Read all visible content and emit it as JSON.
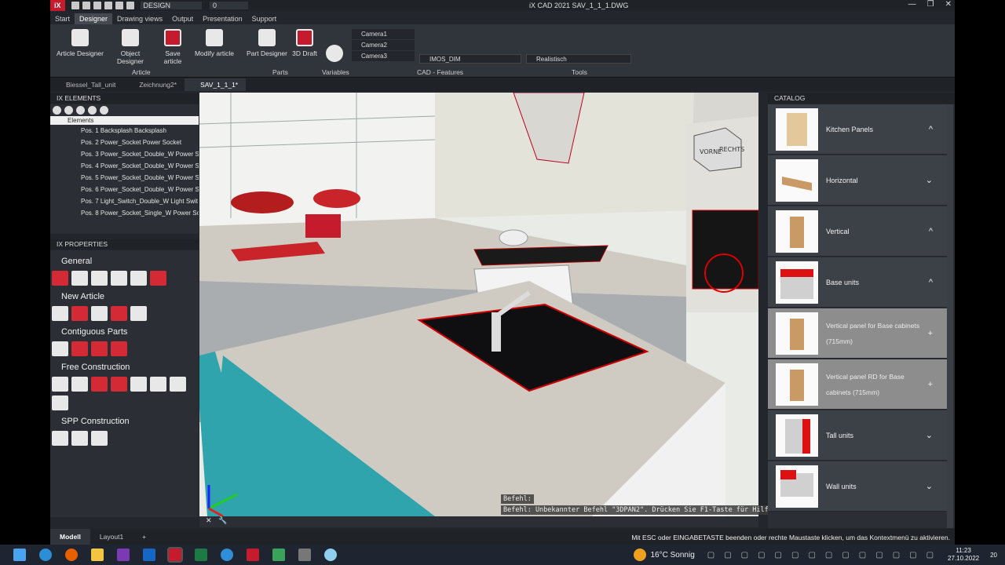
{
  "app": {
    "logo": "iX",
    "workspace": "DESIGN",
    "layer": "0",
    "window_title": "iX CAD 2021    SAV_1_1_1.DWG"
  },
  "menu": [
    "Start",
    "Designer",
    "Drawing views",
    "Output",
    "Presentation",
    "Support"
  ],
  "ribbon": {
    "buttons": [
      "Article Designer",
      "Object Designer",
      "Save article",
      "Modify article",
      "Part Designer",
      "3D Draft",
      "Variables"
    ],
    "groups": [
      "Article",
      "Parts",
      "Variables",
      "CAD - Features",
      "Tools"
    ],
    "cameras": [
      "Camera1",
      "Camera2",
      "Camera3"
    ],
    "dim_style": "IMOS_DIM",
    "visual_style": "Realistisch"
  },
  "doc_tabs": [
    "Biessel_Tall_unit",
    "Zeichnung2*",
    "SAV_1_1_1*"
  ],
  "elements_panel": {
    "title": "IX ELEMENTS",
    "root": "Elements",
    "items": [
      "Pos. 1 Backsplash Backsplash",
      "Pos. 2 Power_Socket Power Socket",
      "Pos. 3 Power_Socket_Double_W Power So",
      "Pos. 4 Power_Socket_Double_W Power So",
      "Pos. 5 Power_Socket_Double_W Power So",
      "Pos. 6 Power_Socket_Double_W Power So",
      "Pos. 7 Light_Switch_Double_W Light Swit",
      "Pos. 8 Power_Socket_Single_W Power So"
    ]
  },
  "properties_panel": {
    "title": "IX PROPERTIES",
    "sections": [
      "General",
      "New Article",
      "Contiguous Parts",
      "Free Construction",
      "SPP Construction"
    ]
  },
  "viewport": {
    "view_cube": [
      "VORNE",
      "RECHTS"
    ],
    "cmd_prompt": "Befehl:",
    "cmd_msg": "Befehl:  Unbekannter Befehl \"3DPAN2\". Drücken Sie F1-Taste für Hilfe."
  },
  "catalog": {
    "title": "CATALOG",
    "items": [
      {
        "label": "Kitchen Panels",
        "ctrl": "^"
      },
      {
        "label": "Horizontal",
        "ctrl": "⌄"
      },
      {
        "label": "Vertical",
        "ctrl": "^"
      },
      {
        "label": "Base units",
        "ctrl": "^"
      },
      {
        "label": "Vertical panel for Base cabinets (715mm)",
        "ctrl": "+",
        "sub": true
      },
      {
        "label": "Vertical panel RD for Base cabinets (715mm)",
        "ctrl": "+",
        "sub": true
      },
      {
        "label": "Tall units",
        "ctrl": "⌄"
      },
      {
        "label": "Wall units",
        "ctrl": "⌄"
      }
    ]
  },
  "status": {
    "layouts": [
      "Modell",
      "Layout1",
      "+"
    ],
    "message": "Mit ESC oder EINGABETASTE beenden oder rechte Maustaste klicken, um das Kontextmenü zu aktivieren."
  },
  "taskbar": {
    "weather": "16°C  Sonnig",
    "time": "11:23",
    "date": "27.10.2022",
    "notif": "20"
  },
  "colors": {
    "accent": "#c61b2c",
    "teal": "#2fa4ac",
    "countertop": "#cfcbc2"
  }
}
